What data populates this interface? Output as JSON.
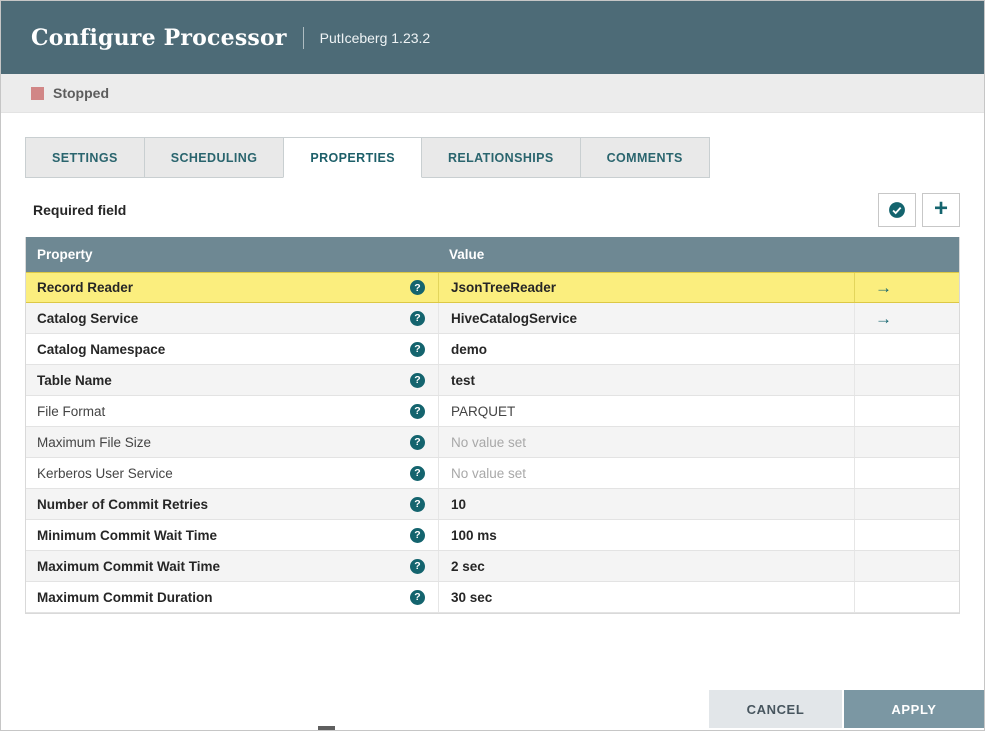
{
  "header": {
    "title": "Configure Processor",
    "subtitle": "PutIceberg 1.23.2"
  },
  "status": {
    "label": "Stopped"
  },
  "tabs": [
    {
      "label": "SETTINGS",
      "active": false
    },
    {
      "label": "SCHEDULING",
      "active": false
    },
    {
      "label": "PROPERTIES",
      "active": true
    },
    {
      "label": "RELATIONSHIPS",
      "active": false
    },
    {
      "label": "COMMENTS",
      "active": false
    }
  ],
  "toolbar": {
    "required_label": "Required field"
  },
  "icons": {
    "stopped": "stopped-square",
    "verify": "circle-check",
    "add": "plus",
    "add_glyph": "+",
    "help": "question-circle",
    "help_glyph": "?",
    "goto": "arrow-right",
    "goto_glyph": "→"
  },
  "table": {
    "headers": {
      "property": "Property",
      "value": "Value"
    },
    "rows": [
      {
        "property": "Record Reader",
        "value": "JsonTreeReader",
        "required": true,
        "highlighted": true,
        "has_goto": true,
        "no_value": false
      },
      {
        "property": "Catalog Service",
        "value": "HiveCatalogService",
        "required": true,
        "highlighted": false,
        "has_goto": true,
        "no_value": false
      },
      {
        "property": "Catalog Namespace",
        "value": "demo",
        "required": true,
        "highlighted": false,
        "has_goto": false,
        "no_value": false
      },
      {
        "property": "Table Name",
        "value": "test",
        "required": true,
        "highlighted": false,
        "has_goto": false,
        "no_value": false
      },
      {
        "property": "File Format",
        "value": "PARQUET",
        "required": false,
        "highlighted": false,
        "has_goto": false,
        "no_value": false
      },
      {
        "property": "Maximum File Size",
        "value": "No value set",
        "required": false,
        "highlighted": false,
        "has_goto": false,
        "no_value": true
      },
      {
        "property": "Kerberos User Service",
        "value": "No value set",
        "required": false,
        "highlighted": false,
        "has_goto": false,
        "no_value": true
      },
      {
        "property": "Number of Commit Retries",
        "value": "10",
        "required": true,
        "highlighted": false,
        "has_goto": false,
        "no_value": false
      },
      {
        "property": "Minimum Commit Wait Time",
        "value": "100 ms",
        "required": true,
        "highlighted": false,
        "has_goto": false,
        "no_value": false
      },
      {
        "property": "Maximum Commit Wait Time",
        "value": "2 sec",
        "required": true,
        "highlighted": false,
        "has_goto": false,
        "no_value": false
      },
      {
        "property": "Maximum Commit Duration",
        "value": "30 sec",
        "required": true,
        "highlighted": false,
        "has_goto": false,
        "no_value": false
      }
    ]
  },
  "footer": {
    "cancel_label": "CANCEL",
    "apply_label": "APPLY"
  },
  "colors": {
    "header_bg": "#4d6b77",
    "accent": "#14646e",
    "stopped_red": "#d18686",
    "table_header_bg": "#6e8893",
    "highlight_bg": "#fbee7e",
    "highlight_border": "#dcc845",
    "apply_bg": "#7b97a3",
    "cancel_bg": "#e2e6e9"
  }
}
